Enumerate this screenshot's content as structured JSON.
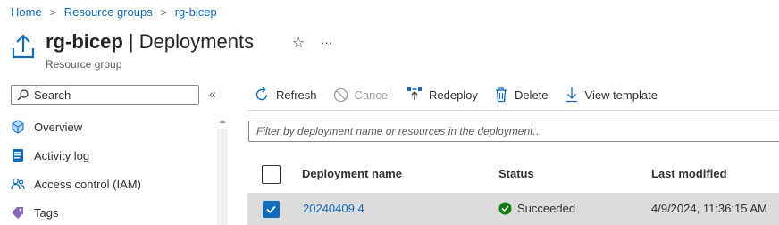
{
  "breadcrumb": {
    "items": [
      "Home",
      "Resource groups",
      "rg-bicep"
    ],
    "separator": ">"
  },
  "header": {
    "title_strong": "rg-bicep",
    "title_rest": " | Deployments",
    "subtitle": "Resource group",
    "favorite_glyph": "☆",
    "more_glyph": "···",
    "icon": "upload-icon"
  },
  "sidebar": {
    "search_placeholder": "Search",
    "collapse_glyph": "«",
    "items": [
      {
        "label": "Overview",
        "icon": "cube-icon"
      },
      {
        "label": "Activity log",
        "icon": "log-icon"
      },
      {
        "label": "Access control (IAM)",
        "icon": "people-icon"
      },
      {
        "label": "Tags",
        "icon": "tag-icon"
      }
    ]
  },
  "toolbar": {
    "refresh": "Refresh",
    "cancel": "Cancel",
    "redeploy": "Redeploy",
    "delete": "Delete",
    "view_template": "View template"
  },
  "filter": {
    "placeholder": "Filter by deployment name or resources in the deployment..."
  },
  "table": {
    "columns": [
      "Deployment name",
      "Status",
      "Last modified"
    ],
    "rows": [
      {
        "name": "20240409.4",
        "status": "Succeeded",
        "last_modified": "4/9/2024, 11:36:15 AM",
        "selected": true
      }
    ]
  },
  "colors": {
    "accent": "#0f6cbd",
    "success": "#107c10",
    "selected_row": "#dcdcdc"
  }
}
